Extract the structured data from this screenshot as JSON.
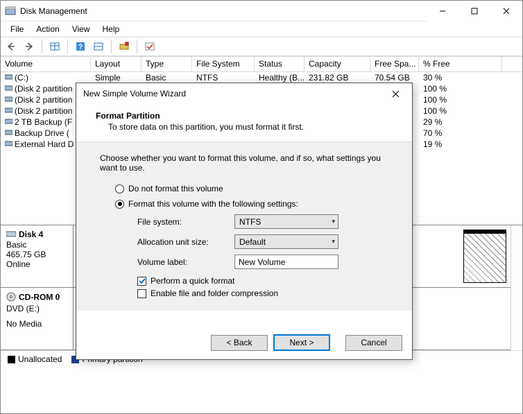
{
  "window": {
    "title": "Disk Management",
    "menu": [
      "File",
      "Action",
      "View",
      "Help"
    ]
  },
  "columns": {
    "volume": "Volume",
    "layout": "Layout",
    "type": "Type",
    "filesystem": "File System",
    "status": "Status",
    "capacity": "Capacity",
    "freespace": "Free Spa...",
    "pctfree": "% Free"
  },
  "rows": [
    {
      "vol": "(C:)",
      "layout": "Simple",
      "type": "Basic",
      "fs": "NTFS",
      "status": "Healthy (B...",
      "cap": "231.82 GB",
      "free": "70.54 GB",
      "pfree": "30 %"
    },
    {
      "vol": "(Disk 2 partition",
      "pfree": "100 %"
    },
    {
      "vol": "(Disk 2 partition",
      "pfree": "100 %"
    },
    {
      "vol": "(Disk 2 partition",
      "pfree": "100 %"
    },
    {
      "vol": "2 TB Backup (F",
      "pfree": "29 %"
    },
    {
      "vol": "Backup Drive (",
      "pfree": "70 %"
    },
    {
      "vol": "External Hard D",
      "pfree": "19 %"
    }
  ],
  "disks": {
    "d4": {
      "title": "Disk 4",
      "sub1": "Basic",
      "sub2": "465.75 GB",
      "sub3": "Online"
    },
    "cd": {
      "title": "CD-ROM 0",
      "sub1": "DVD (E:)",
      "sub2": "No Media"
    }
  },
  "legend": {
    "unallocated": "Unallocated",
    "primary": "Primary partition"
  },
  "dialog": {
    "title": "New Simple Volume Wizard",
    "heading": "Format Partition",
    "sub": "To store data on this partition, you must format it first.",
    "instruction": "Choose whether you want to format this volume, and if so, what settings you want to use.",
    "opt_no_format": "Do not format this volume",
    "opt_format": "Format this volume with the following settings:",
    "lbl_fs": "File system:",
    "val_fs": "NTFS",
    "lbl_au": "Allocation unit size:",
    "val_au": "Default",
    "lbl_label": "Volume label:",
    "val_label": "New Volume",
    "cb_quick": "Perform a quick format",
    "cb_compress": "Enable file and folder compression",
    "btn_back": "< Back",
    "btn_next": "Next >",
    "btn_cancel": "Cancel"
  }
}
